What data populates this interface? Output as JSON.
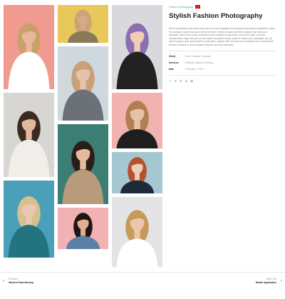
{
  "project": {
    "category": "Fashion Photography",
    "title": "Stylish Fashion Photography",
    "description": "Sed ut perspiciatis unde omnis iste natus error sit voluptatem accusantium doloremque laudantium, totam rem aperiam, eaque ipsa quae ab illo inventore veritatis et quasi architecto beatae vitae dicta sunt explicabo. Nemo enim ipsam voluptatem quia voluptas sit aspernatur aut odit aut fugit, sed quia consequuntur magni dolores eos qui ratione voluptatem sequi nesciunt. Neque porro quisquam est, qui dolorem ipsum quia dolor sit amet, consectetur, adipisci velit, sed quia non numquam eius modi tempora incidunt ut labore et dolore magnam aliquam quaerat voluptatem.",
    "meta": [
      {
        "label": "Client",
        "value": "Cohn Creative Company"
      },
      {
        "label": "Services",
        "value": "Editorial, Fashion & Beauty"
      },
      {
        "label": "Date",
        "value": "February 9, 2019"
      }
    ],
    "share_icons": [
      "facebook-icon",
      "twitter-icon",
      "pinterest-icon",
      "linkedin-icon",
      "email-icon"
    ]
  },
  "navigation": {
    "prev_label": "Previous",
    "prev_title": "Stickers Pack Mockup",
    "next_label": "Next Post",
    "next_title": "Mobile Application"
  },
  "colors": {
    "accent": "#2bb3c0",
    "title": "#1b1b1b",
    "text_muted": "#888888"
  },
  "gallery": [
    {
      "name": "photo-woman-pink-background",
      "bg": "#f19a8f",
      "skin": "#e8b79a",
      "hair": "#c9a06a",
      "cloth": "#ffffff"
    },
    {
      "name": "photo-woman-yellow-background",
      "bg": "#e8c85a",
      "skin": "#d9a98a",
      "hair": "#caa476",
      "cloth": "#8a7a5a"
    },
    {
      "name": "photo-woman-purple-hair",
      "bg": "#d9d9dd",
      "skin": "#f1cdb8",
      "hair": "#8a6fb3",
      "cloth": "#222222"
    },
    {
      "name": "photo-woman-gray-hoodie",
      "bg": "#cfd8dc",
      "skin": "#e6c2a8",
      "hair": "#c9a07a",
      "cloth": "#6c7178"
    },
    {
      "name": "photo-woman-white-suit",
      "bg": "#d8d6d2",
      "skin": "#e1b89c",
      "hair": "#3a2a22",
      "cloth": "#f1eee9"
    },
    {
      "name": "photo-woman-pink-wall",
      "bg": "#f1b2b0",
      "skin": "#e6c0a8",
      "hair": "#b08054",
      "cloth": "#1e1e1e"
    },
    {
      "name": "photo-woman-teddy-bear",
      "bg": "#3c7d74",
      "skin": "#e5bba0",
      "hair": "#2a1d16",
      "cloth": "#b89a7c"
    },
    {
      "name": "photo-woman-red-hair",
      "bg": "#a4c7d2",
      "skin": "#f0cdb8",
      "hair": "#b4522f",
      "cloth": "#1c2a3a"
    },
    {
      "name": "photo-woman-in-water",
      "bg": "#4aa0b8",
      "skin": "#e9c8b3",
      "hair": "#d7c08f",
      "cloth": "#23747f"
    },
    {
      "name": "photo-woman-denim-jacket",
      "bg": "#f2b2b4",
      "skin": "#e0b090",
      "hair": "#1e1614",
      "cloth": "#5a7fa8"
    },
    {
      "name": "photo-woman-long-blonde-hair",
      "bg": "#e4e4e6",
      "skin": "#ecc6ac",
      "hair": "#c69a58",
      "cloth": "#ffffff"
    }
  ]
}
